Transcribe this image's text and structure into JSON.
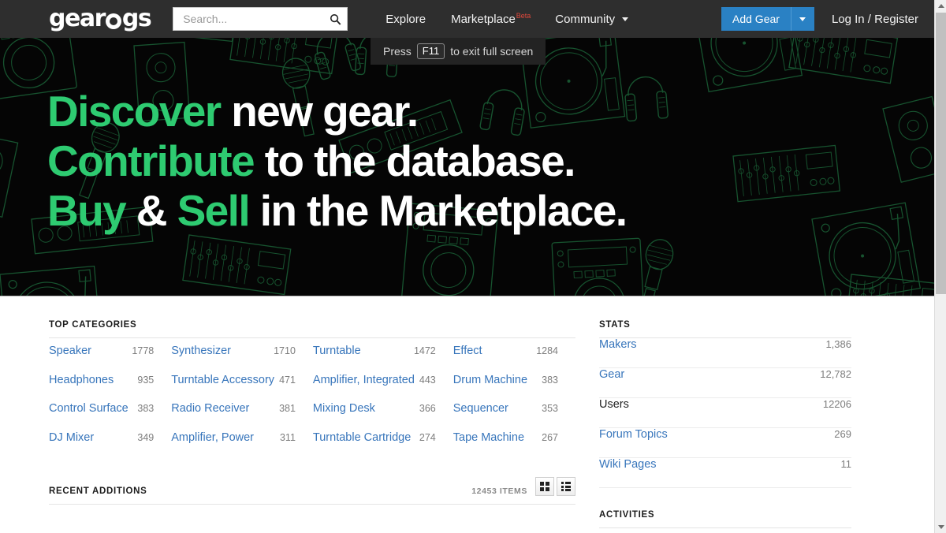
{
  "browser": {
    "fullscreen_toast": {
      "prefix": "Press",
      "key": "F11",
      "suffix": "to exit full screen"
    }
  },
  "navbar": {
    "logo_text": "gear",
    "logo_text_tail": "gs",
    "logo_name": "gearogs",
    "search": {
      "placeholder": "Search...",
      "value": "",
      "icon": "search-icon"
    },
    "links": [
      {
        "label": "Explore",
        "badge": ""
      },
      {
        "label": "Marketplace",
        "badge": "Beta"
      },
      {
        "label": "Community",
        "badge": "",
        "caret": true
      }
    ],
    "add_gear_label": "Add Gear",
    "login_label": "Log In / Register",
    "colors": {
      "bar_bg": "#2e2e2e",
      "primary": "#2a81c4",
      "beta": "#e0483c"
    }
  },
  "hero": {
    "line1_accent": "Discover",
    "line1_rest": " new gear.",
    "line2_accent": "Contribute",
    "line2_rest": " to the database.",
    "line3_accent_a": "Buy",
    "line3_mid": " & ",
    "line3_accent_b": "Sell",
    "line3_rest": " in the Marketplace.",
    "accent_color": "#2ecb71",
    "background_color": "#050505",
    "art_color": "#14532d",
    "art_description": "line-art audio gear pattern"
  },
  "top_categories": {
    "title": "TOP CATEGORIES",
    "items": [
      {
        "name": "Speaker",
        "count": "1778"
      },
      {
        "name": "Synthesizer",
        "count": "1710"
      },
      {
        "name": "Turntable",
        "count": "1472"
      },
      {
        "name": "Effect",
        "count": "1284"
      },
      {
        "name": "Headphones",
        "count": "935"
      },
      {
        "name": "Turntable Accessory",
        "count": "471"
      },
      {
        "name": "Amplifier, Integrated",
        "count": "443"
      },
      {
        "name": "Drum Machine",
        "count": "383"
      },
      {
        "name": "Control Surface",
        "count": "383"
      },
      {
        "name": "Radio Receiver",
        "count": "381"
      },
      {
        "name": "Mixing Desk",
        "count": "366"
      },
      {
        "name": "Sequencer",
        "count": "353"
      },
      {
        "name": "DJ Mixer",
        "count": "349"
      },
      {
        "name": "Amplifier, Power",
        "count": "311"
      },
      {
        "name": "Turntable Cartridge",
        "count": "274"
      },
      {
        "name": "Tape Machine",
        "count": "267"
      }
    ]
  },
  "recent_additions": {
    "title": "RECENT ADDITIONS",
    "items_count": "12453 ITEMS",
    "view_grid_icon": "grid-view-icon",
    "view_list_icon": "list-view-icon"
  },
  "stats": {
    "title": "STATS",
    "rows": [
      {
        "name": "Makers",
        "value": "1,386",
        "link": true
      },
      {
        "name": "Gear",
        "value": "12,782",
        "link": true
      },
      {
        "name": "Users",
        "value": "12206",
        "link": false
      },
      {
        "name": "Forum Topics",
        "value": "269",
        "link": true
      },
      {
        "name": "Wiki Pages",
        "value": "11",
        "link": true
      }
    ]
  },
  "activities": {
    "title": "ACTIVITIES"
  },
  "scrollbar": {
    "up_icon": "scroll-up-arrow-icon",
    "down_icon": "scroll-down-arrow-icon"
  }
}
